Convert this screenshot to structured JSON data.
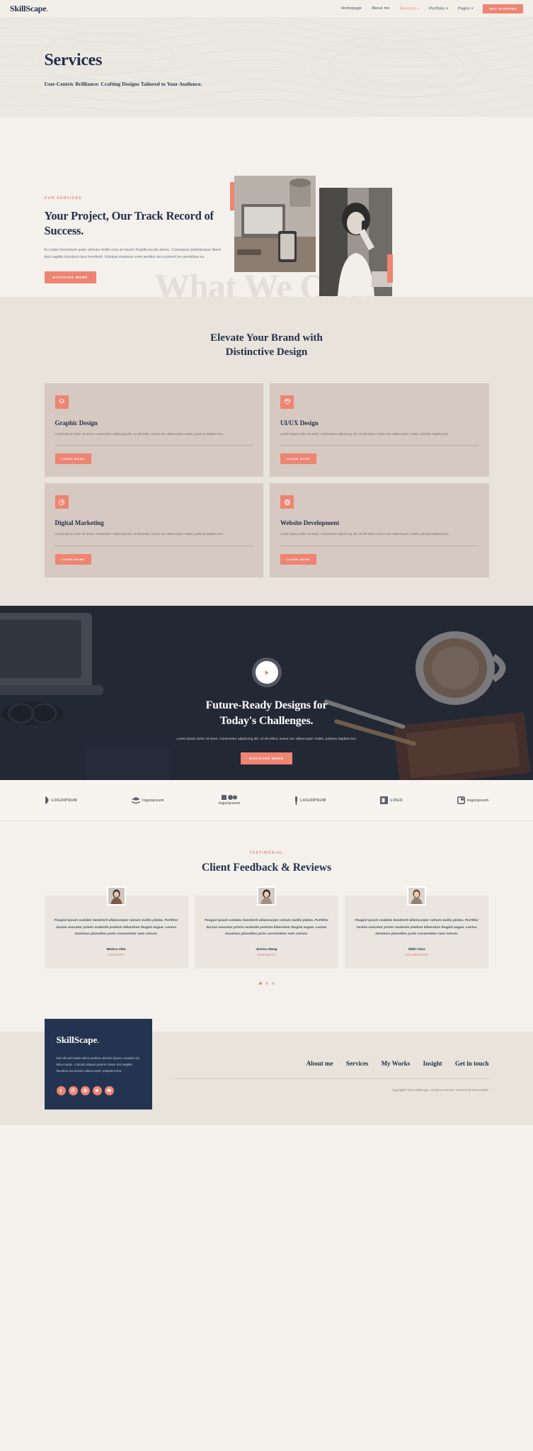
{
  "brand": {
    "name": "SkillScape",
    "dot": "."
  },
  "nav": {
    "items": [
      {
        "label": "Homepage",
        "active": false,
        "caret": false
      },
      {
        "label": "About me",
        "active": false,
        "caret": false
      },
      {
        "label": "Services",
        "active": true,
        "caret": true
      },
      {
        "label": "Portfolio",
        "active": false,
        "caret": true
      },
      {
        "label": "Pages",
        "active": false,
        "caret": true
      }
    ],
    "cta_label": "GET STARTED",
    "caret_glyph": "▾"
  },
  "hero": {
    "title": "Services",
    "subtitle": "User-Centric Brilliance: Crafting Designs Tailored to Your Audience."
  },
  "intro": {
    "eyebrow": "OUR SERVICES",
    "heading": "Your Project, Our Track Record of Success.",
    "body": "Eu turpis fermentum pede ultricies mollis cras at mauris fringilla iaculis donec. Consequat pellentesque libero duis sagittis tincidunt risus hendrerit. Volutpat maximus enim porttitor arcu potenti leo penatibus eu.",
    "button": "DISCOVER MORE",
    "watermark": "What We Offer"
  },
  "services": {
    "heading_line1": "Elevate Your Brand with",
    "heading_line2": "Distinctive Design",
    "cards": [
      {
        "icon": "layers-icon",
        "title": "Graphic Design",
        "body": "Lorem ipsum dolor sit amet, consectetur adipiscing elit. Ut elit tellus, luctus nec ullamcorper mattis, pulvinar dapibus leo.",
        "button": "LEARN MORE"
      },
      {
        "icon": "gem-icon",
        "title": "UI/UX Design",
        "body": "Lorem ipsum dolor sit amet, consectetur adipiscing elit. Ut elit tellus, luctus nec ullamcorper mattis, pulvinar dapibus leo.",
        "button": "LEARN MORE"
      },
      {
        "icon": "megaphone-icon",
        "title": "Digital Marketing",
        "body": "Lorem ipsum dolor sit amet, consectetur adipiscing elit. Ut elit tellus, luctus nec ullamcorper mattis, pulvinar dapibus leo.",
        "button": "LEARN MORE"
      },
      {
        "icon": "globe-icon",
        "title": "Website Development",
        "body": "Lorem ipsum dolor sit amet, consectetur adipiscing elit. Ut elit tellus, luctus nec ullamcorper mattis, pulvinar dapibus leo.",
        "button": "LEARN MORE"
      }
    ]
  },
  "video": {
    "heading_line1": "Future-Ready Designs for",
    "heading_line2": "Today's Challenges.",
    "body": "Lorem ipsum dolor sit amet, consectetur adipiscing elit. Ut elit tellus, luctus nec ullamcorper mattis, pulvinar dapibus leo.",
    "button": "DISCOVER MORE",
    "play_label": "Play video"
  },
  "logos": [
    {
      "name": "LOGOIPSUM",
      "icon": "logoipsum-leaf-icon"
    },
    {
      "name": "logoipsum",
      "icon": "logoipsum-stack-icon"
    },
    {
      "name": "logoipsum",
      "icon": "logoipsum-dots-icon"
    },
    {
      "name": "LOGOIPSUM",
      "icon": "logoipsum-pin-icon"
    },
    {
      "name": "LOGO",
      "icon": "logoipsum-block-icon"
    },
    {
      "name": "logoipsum",
      "icon": "logoipsum-square-icon"
    }
  ],
  "testimonials": {
    "eyebrow": "TESTIMONIAL",
    "heading": "Client Feedback & Reviews",
    "items": [
      {
        "quote": "Feugiat ipsum sodales hendrerit ullamcorper rutrum mollis platea. Porttitor lacinia nascetur primis molestie pretium bibendum feugiat augue. Lectus maximus phasellus justo consectetur nam rutrum.",
        "name": "Monica Alba",
        "city": "JAKARTA"
      },
      {
        "quote": "Feugiat ipsum sodales hendrerit ullamcorper rutrum mollis platea. Porttitor lacinia nascetur primis molestie pretium bibendum feugiat augue. Lectus maximus phasellus justo consectetur nam rutrum.",
        "name": "Jessica Wang",
        "city": "SURABAYA"
      },
      {
        "quote": "Feugiat ipsum sodales hendrerit ullamcorper rutrum mollis platea. Porttitor lacinia nascetur primis molestie pretium bibendum feugiat augue. Lectus maximus phasellus justo consectetur nam rutrum.",
        "name": "Nikki Clara",
        "city": "KALIMANTAN"
      }
    ],
    "dots": [
      true,
      false,
      false
    ]
  },
  "footer": {
    "brand": "SkillScape",
    "brand_dot": ".",
    "about": "Non dis ad mattis tellus pretium ultricies ipsum conubia nisi letius turpis. Lobortis aliquet potenti metus nisl sagittis faucibus accumsan ullamcorper volutpat tortor.",
    "socials": [
      {
        "name": "facebook-icon"
      },
      {
        "name": "instagram-icon"
      },
      {
        "name": "pinterest-icon"
      },
      {
        "name": "twitter-icon"
      },
      {
        "name": "youtube-icon"
      }
    ],
    "links": [
      {
        "label": "About me"
      },
      {
        "label": "Services"
      },
      {
        "label": "My Works"
      },
      {
        "label": "Insight"
      },
      {
        "label": "Get in touch"
      }
    ],
    "separator": "·",
    "copyright": "Copyright© 2024 SkillScape. All rights reserved. Powered by MosCreative"
  },
  "colors": {
    "coral": "#ee8472",
    "navy": "#22344f",
    "cream": "#f4f1ec",
    "card": "#d6c9c1",
    "section": "#e8e3db"
  }
}
